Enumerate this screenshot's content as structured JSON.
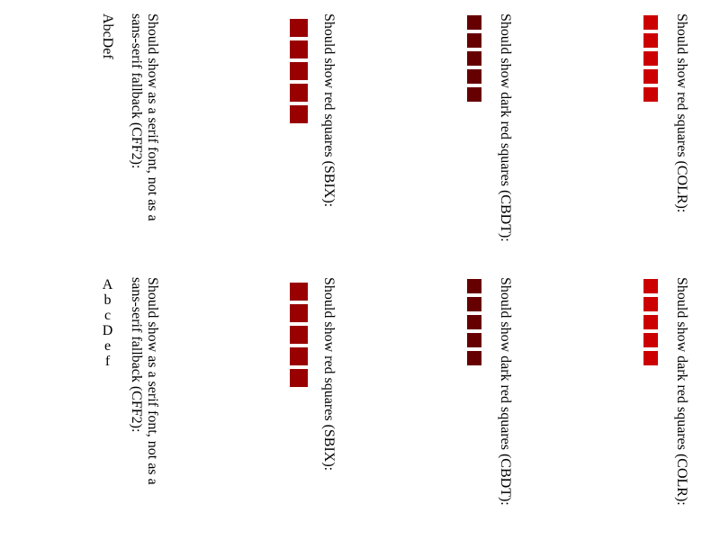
{
  "colors": {
    "colr_red": "#cc0000",
    "cbdt_dark_red": "#660000",
    "sbix_red": "#990000",
    "text": "#000000"
  },
  "columns": {
    "top": {
      "colr_label": "Should show red squares (COLR):",
      "cbdt_label": "Should show dark red squares (CBDT):",
      "sbix_label": "Should show red squares (SBIX):",
      "cff2_label_line1": "Should show as a serif font, not as a",
      "cff2_label_line2": "sans-serif fallback (CFF2):",
      "cff2_sample": "AbcDef"
    },
    "bottom": {
      "colr_label": "Should show dark red squares (COLR):",
      "cbdt_label": "Should show dark red squares (CBDT):",
      "sbix_label": "Should show red squares (SBIX):",
      "cff2_label_line1": "Should show as a serif font, not as a",
      "cff2_label_line2": "sans-serif fallback (CFF2):",
      "cff2_sample": "AbcDef"
    }
  },
  "square_counts": {
    "colr": 5,
    "cbdt": 5,
    "sbix": 5
  }
}
